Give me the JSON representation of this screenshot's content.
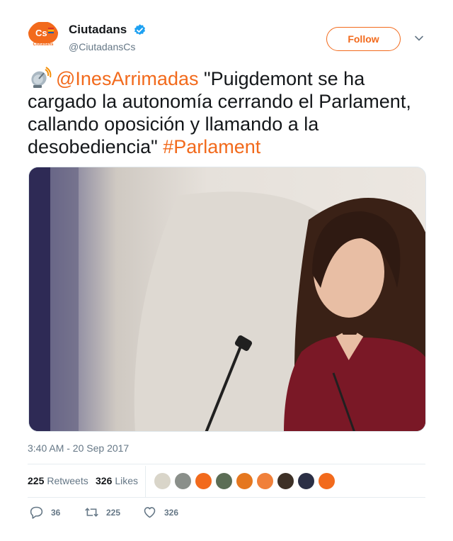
{
  "account": {
    "display_name": "Ciutadans",
    "handle": "@CiutadansCs",
    "avatar_text": "Cs",
    "avatar_subtext": "Ciutadans",
    "verified": true
  },
  "header": {
    "follow_label": "Follow"
  },
  "tweet": {
    "mention": "@InesArrimadas",
    "text": " \"Puigdemont se ha cargado la autonomía cerrando el Parlament, callando oposición y llamando a la desobediencia\" ",
    "hashtag": "#Parlament",
    "emoji": "satellite-antenna-icon"
  },
  "media": {
    "description_icon": "photo"
  },
  "timestamp": "3:40 AM - 20 Sep 2017",
  "stats": {
    "retweets_count": "225",
    "retweets_label": "Retweets",
    "likes_count": "326",
    "likes_label": "Likes"
  },
  "actions": {
    "replies": "36",
    "retweets": "225",
    "likes": "326"
  },
  "colors": {
    "brand": "#f26a1c",
    "verified": "#1da1f2",
    "muted": "#657786",
    "text": "#14171a"
  }
}
